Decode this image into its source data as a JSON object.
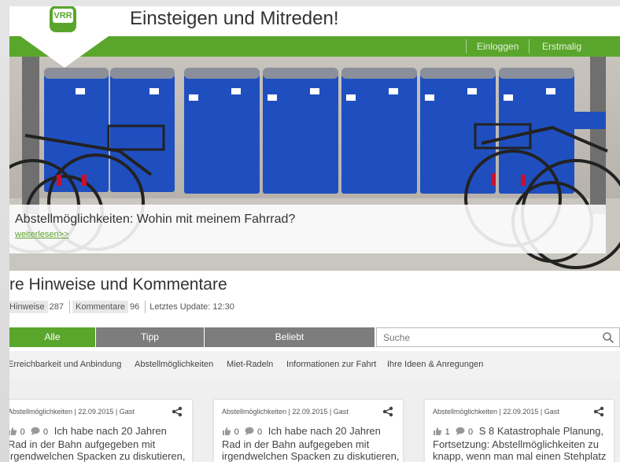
{
  "header": {
    "title": "Einsteigen und Mitreden!",
    "logo_text": "VRR",
    "login_label": "Einloggen",
    "register_label": "Erstmalig anmelden"
  },
  "hero": {
    "title": "Abstellmöglichkeiten: Wohin mit meinem Fahrrad?",
    "link": "weiterlesen>>"
  },
  "section": {
    "title": "re Hinweise und Kommentare",
    "hints_label": "Hinweise",
    "hints_count": "287",
    "comments_label": "Kommentare",
    "comments_count": "96",
    "update_label": "Letztes Update: 12:30"
  },
  "tabs": {
    "all": "Alle",
    "tip": "Tipp",
    "popular": "Beliebt"
  },
  "search": {
    "placeholder": "Suche"
  },
  "categories": [
    "Erreichbarkeit und Anbindung",
    "Abstellmöglichkeiten",
    "Miet-Radeln",
    "Informationen zur Fahrt",
    "Ihre Ideen & Anregungen"
  ],
  "cards": [
    {
      "meta": "Abstellmöglichkeiten | 22.09.2015 | Gast",
      "likes": "0",
      "comments": "0",
      "text": "Ich habe nach 20 Jahren Rad in der Bahn aufgegeben mit irgendwelchen Spacken zu diskutieren,"
    },
    {
      "meta": "Abstellmöglichkeiten | 22.09.2015 | Gast",
      "likes": "0",
      "comments": "0",
      "text": "Ich habe nach 20 Jahren Rad in der Bahn aufgegeben mit irgendwelchen Spacken zu diskutieren,"
    },
    {
      "meta": "Abstellmöglichkeiten | 22.09.2015 | Gast",
      "likes": "1",
      "comments": "0",
      "text": "S 8 Katastrophale Planung, Fortsetzung: Abstellmöglichkeiten zu knapp, wenn man mal einen Stehplatz"
    }
  ],
  "colors": {
    "brand_green": "#5aa62c",
    "tab_grey": "#7d7d7d",
    "locker_blue": "#1f4fbf"
  }
}
